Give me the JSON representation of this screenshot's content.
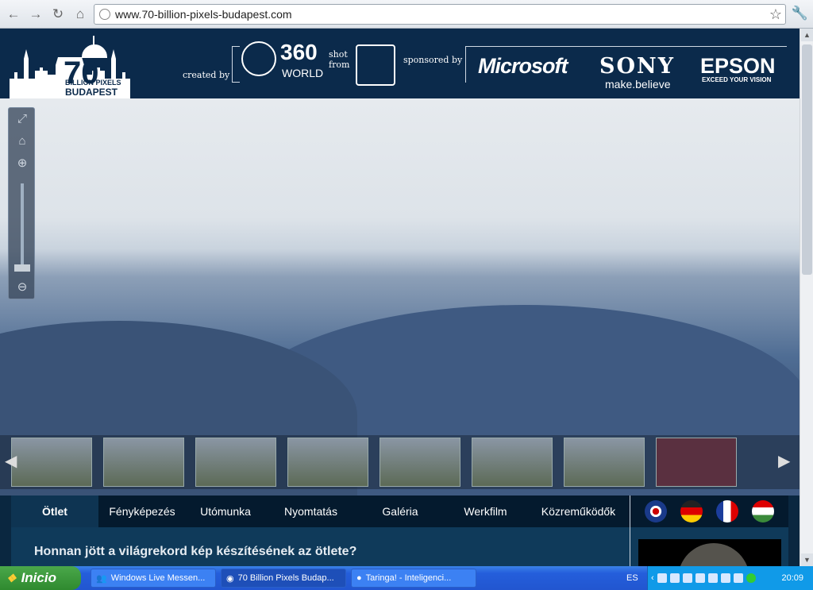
{
  "browser": {
    "url": "www.70-billion-pixels-budapest.com"
  },
  "header": {
    "logo_number": "70",
    "logo_line1": "BILLION PIXELS",
    "logo_line2": "BUDAPEST",
    "created_by": "created by",
    "brand_360": "360",
    "brand_world": "WORLD",
    "shot_from": "shot from",
    "sponsored_by": "sponsored by",
    "sponsors": [
      "Microsoft",
      "SONY",
      "EPSON"
    ],
    "sony_tagline": "make.believe",
    "epson_tagline": "EXCEED YOUR VISION"
  },
  "nav": {
    "tabs": [
      "Ötlet",
      "Fényképezés",
      "Utómunka",
      "Nyomtatás",
      "Galéria",
      "Werkfilm",
      "Közreműködők"
    ],
    "active": 0,
    "languages": [
      "English",
      "Deutsch",
      "Français",
      "Magyar"
    ]
  },
  "content": {
    "heading": "Honnan jött a világrekord kép készítésének az ötlete?"
  },
  "taskbar": {
    "start": "Inicio",
    "tasks": [
      "Windows Live Messen...",
      "70 Billion Pixels Budap...",
      "Taringa! - Inteligenci..."
    ],
    "language": "ES",
    "clock": "20:09"
  }
}
